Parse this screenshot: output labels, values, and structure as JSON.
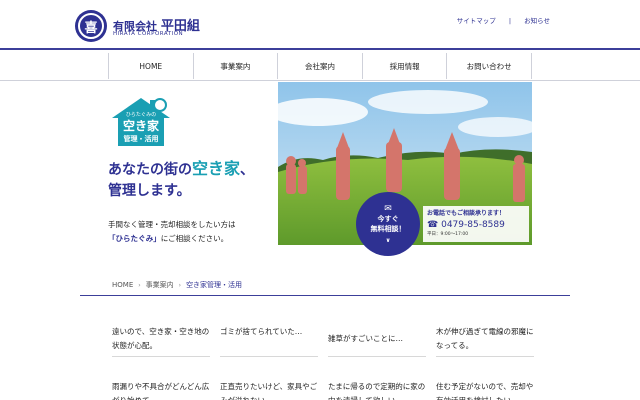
{
  "header": {
    "logo_char": "喜",
    "company_prefix": "有限会社",
    "company_name": "平田組",
    "company_en": "HIRATA CORPORATION",
    "links": [
      "サイトマップ",
      "お知らせ"
    ],
    "link_separator": "|"
  },
  "nav": {
    "items": [
      "HOME",
      "事業案内",
      "会社案内",
      "採用情報",
      "お問い合わせ"
    ]
  },
  "hero": {
    "badge_top": "ひらたぐみの",
    "badge_main": "空き家",
    "badge_sub": "管理・活用",
    "headline_1": "あなたの街の",
    "headline_accent": "空き家",
    "headline_2": "、",
    "headline_3": "管理します。",
    "desc_1": "手間なく管理・売却相談をしたい方は",
    "desc_hl": "「ひらたぐみ」",
    "desc_2": "にご相談ください。"
  },
  "consult": {
    "line1": "今すぐ",
    "line2": "無料相談！",
    "mail_icon": "envelope-icon",
    "chevron_icon": "chevron-down-icon"
  },
  "phone": {
    "lead": "お電話でもご相談承ります！",
    "number": "0479-85-8589",
    "hours": "平日：9:00〜17:00"
  },
  "breadcrumb": {
    "items": [
      "HOME",
      "事業案内",
      "空き家管理・活用"
    ]
  },
  "cards": [
    {
      "text": "遠いので、空き家・空き地の状態が心配。"
    },
    {
      "text": "ゴミが捨てられていた…"
    },
    {
      "text": "雑草がすごいことに…"
    },
    {
      "text": "木が伸び過ぎて電線の邪魔になってる。"
    },
    {
      "text": "雨漏りや不具合がどんどん広がり始めて…"
    },
    {
      "text": "正直売りたいけど、家具やごみが溢れない…"
    },
    {
      "text": "たまに帰るので定期的に家の中を清掃して欲しい…"
    },
    {
      "text": "住む予定がないので、売却や有効活用を検討したい。"
    }
  ],
  "colors": {
    "brand_navy": "#2e3192",
    "accent_teal": "#1a9fb3"
  }
}
